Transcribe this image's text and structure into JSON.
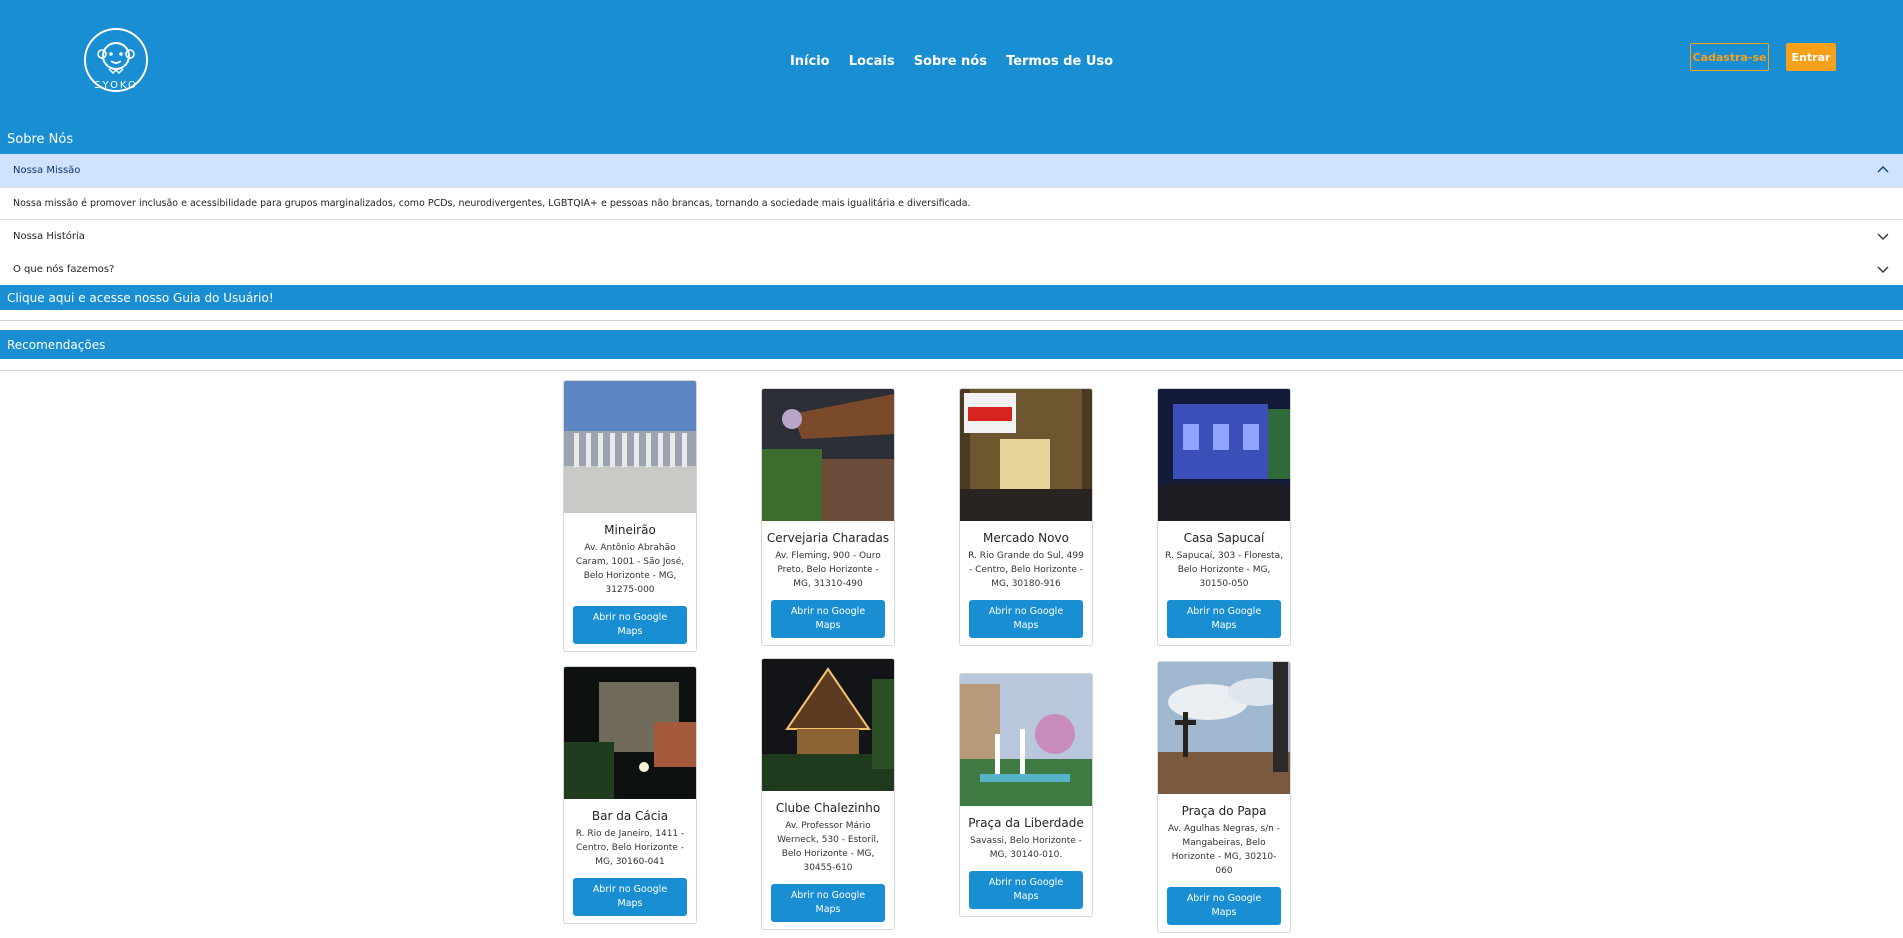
{
  "brand": {
    "logo_text": "SYOKO"
  },
  "nav": [
    "Início",
    "Locais",
    "Sobre nós",
    "Termos de Uso"
  ],
  "auth": {
    "signup": "Cadastra-se",
    "login": "Entrar"
  },
  "about": {
    "title": "Sobre Nós",
    "items": [
      {
        "title": "Nossa Missão",
        "expanded": true,
        "body": "Nossa missão é promover inclusão e acessibilidade para grupos marginalizados, como PCDs, neurodivergentes, LGBTQIA+ e pessoas não brancas, tornando a sociedade mais igualitária e diversificada."
      },
      {
        "title": "Nossa História",
        "expanded": false
      },
      {
        "title": "O que nós fazemos?",
        "expanded": false
      }
    ]
  },
  "guide_link": "Clique aqui e acesse nosso Guia do Usuário!",
  "recommendations": {
    "title": "Recomendações",
    "button_label": "Abrir no Google Maps",
    "places": [
      {
        "name": "Mineirão",
        "address": "Av. Antônio Abrahão Caram, 1001 - São José, Belo Horizonte - MG, 31275-000"
      },
      {
        "name": "Cervejaria Charadas",
        "address": "Av. Fleming, 900 - Ouro Preto, Belo Horizonte - MG, 31310-490"
      },
      {
        "name": "Mercado Novo",
        "address": "R. Rio Grande do Sul, 499 - Centro, Belo Horizonte - MG, 30180-916"
      },
      {
        "name": "Casa Sapucaí",
        "address": "R. Sapucaí, 303 - Floresta, Belo Horizonte - MG, 30150-050"
      },
      {
        "name": "Bar da Cácia",
        "address": "R. Rio de Janeiro, 1411 - Centro, Belo Horizonte - MG, 30160-041"
      },
      {
        "name": "Clube Chalezinho",
        "address": "Av. Professor Mário Werneck, 530 - Estoril, Belo Horizonte - MG, 30455-610"
      },
      {
        "name": "Praça da Liberdade",
        "address": "Savassi, Belo Horizonte - MG, 30140-010."
      },
      {
        "name": "Praça do Papa",
        "address": "Av. Agulhas Negras, s/n - Mangabeiras, Belo Horizonte - MG, 30210-060"
      }
    ]
  },
  "colors": {
    "primary": "#1a8ed3",
    "accent": "#f7a11a",
    "accordion_open": "#cfe2ff"
  }
}
